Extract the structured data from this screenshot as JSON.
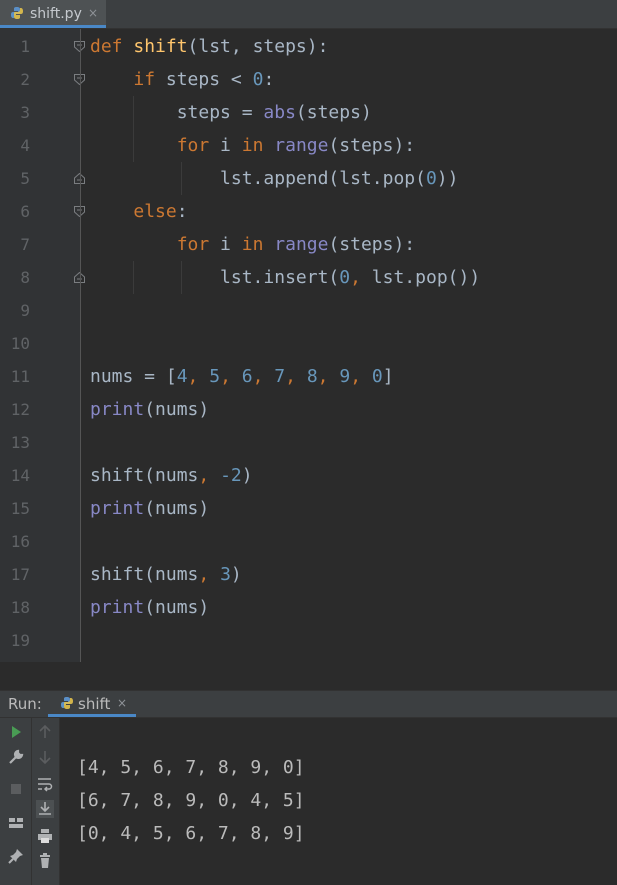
{
  "editor_tab": {
    "filename": "shift.py",
    "close": "×"
  },
  "line_numbers": [
    "1",
    "2",
    "3",
    "4",
    "5",
    "6",
    "7",
    "8",
    "9",
    "10",
    "11",
    "12",
    "13",
    "14",
    "15",
    "16",
    "17",
    "18",
    "19"
  ],
  "code": {
    "l1": {
      "kw": "def",
      "fn": "shift",
      "rest": "(lst, steps):"
    },
    "l2": {
      "kw": "if",
      "mid": " steps < ",
      "num": "0",
      "end": ":"
    },
    "l3": {
      "a": "steps = ",
      "bi": "abs",
      "b": "(steps)"
    },
    "l4": {
      "kw1": "for",
      "a": " i ",
      "kw2": "in",
      "sp": " ",
      "bi": "range",
      "b": "(steps):"
    },
    "l5": {
      "a": "lst.append(lst.pop(",
      "num": "0",
      "b": "))"
    },
    "l6": {
      "kw": "else",
      "end": ":"
    },
    "l7": {
      "kw1": "for",
      "a": " i ",
      "kw2": "in",
      "sp": " ",
      "bi": "range",
      "b": "(steps):"
    },
    "l8": {
      "a": "lst.insert(",
      "num": "0",
      "c": ", ",
      "b": "lst.pop())"
    },
    "l11": {
      "a": "nums = [",
      "items": [
        "4",
        "5",
        "6",
        "7",
        "8",
        "9",
        "0"
      ],
      "end": "]"
    },
    "l12": {
      "bi": "print",
      "b": "(nums)"
    },
    "l14": {
      "a": "shift(nums",
      "c": ", ",
      "num": "-2",
      "b": ")"
    },
    "l15": {
      "bi": "print",
      "b": "(nums)"
    },
    "l17": {
      "a": "shift(nums",
      "c": ", ",
      "num": "3",
      "b": ")"
    },
    "l18": {
      "bi": "print",
      "b": "(nums)"
    }
  },
  "run_panel": {
    "label": "Run:",
    "tab_name": "shift",
    "close": "×",
    "output": [
      "[4, 5, 6, 7, 8, 9, 0]",
      "[6, 7, 8, 9, 0, 4, 5]",
      "[0, 4, 5, 6, 7, 8, 9]"
    ]
  },
  "colors": {
    "keyword": "#cc7832",
    "function": "#ffc66d",
    "number": "#6897bb",
    "builtin": "#8888c6",
    "accent": "#4a88c7"
  }
}
